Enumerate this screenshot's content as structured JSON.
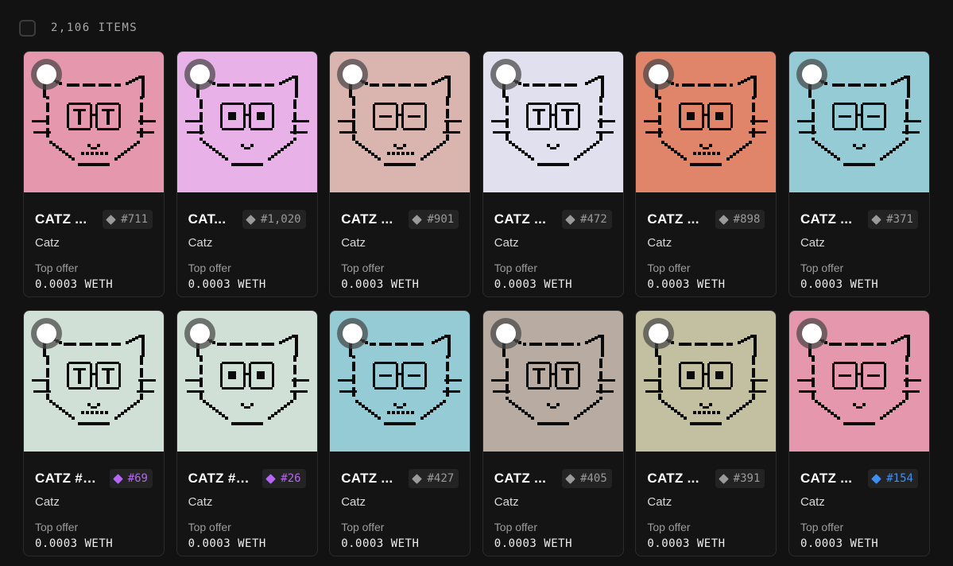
{
  "header": {
    "item_count": "2,106 ITEMS"
  },
  "colors": {
    "rank_grey": "#9a9a9a",
    "rank_purple": "#b566f2",
    "rank_blue": "#3f8ff2"
  },
  "cards": [
    {
      "title": "CATZ ...",
      "rank": "#711",
      "rank_color": "grey",
      "bg": "#e597ad",
      "collection": "Catz",
      "offer_label": "Top offer",
      "offer_value": "0.0003 WETH"
    },
    {
      "title": "CAT...",
      "rank": "#1,020",
      "rank_color": "grey",
      "bg": "#e8b1e8",
      "collection": "Catz",
      "offer_label": "Top offer",
      "offer_value": "0.0003 WETH"
    },
    {
      "title": "CATZ ...",
      "rank": "#901",
      "rank_color": "grey",
      "bg": "#dab4af",
      "collection": "Catz",
      "offer_label": "Top offer",
      "offer_value": "0.0003 WETH"
    },
    {
      "title": "CATZ ...",
      "rank": "#472",
      "rank_color": "grey",
      "bg": "#e0e0ef",
      "collection": "Catz",
      "offer_label": "Top offer",
      "offer_value": "0.0003 WETH"
    },
    {
      "title": "CATZ ...",
      "rank": "#898",
      "rank_color": "grey",
      "bg": "#e0846a",
      "collection": "Catz",
      "offer_label": "Top offer",
      "offer_value": "0.0003 WETH"
    },
    {
      "title": "CATZ ...",
      "rank": "#371",
      "rank_color": "grey",
      "bg": "#95cbd4",
      "collection": "Catz",
      "offer_label": "Top offer",
      "offer_value": "0.0003 WETH"
    },
    {
      "title": "CATZ #1...",
      "rank": "#69",
      "rank_color": "purple",
      "bg": "#d1e0d6",
      "collection": "Catz",
      "offer_label": "Top offer",
      "offer_value": "0.0003 WETH"
    },
    {
      "title": "CATZ #1...",
      "rank": "#26",
      "rank_color": "purple",
      "bg": "#d1e0d6",
      "collection": "Catz",
      "offer_label": "Top offer",
      "offer_value": "0.0003 WETH"
    },
    {
      "title": "CATZ ...",
      "rank": "#427",
      "rank_color": "grey",
      "bg": "#95cbd4",
      "collection": "Catz",
      "offer_label": "Top offer",
      "offer_value": "0.0003 WETH"
    },
    {
      "title": "CATZ ...",
      "rank": "#405",
      "rank_color": "grey",
      "bg": "#b8aba2",
      "collection": "Catz",
      "offer_label": "Top offer",
      "offer_value": "0.0003 WETH"
    },
    {
      "title": "CATZ ...",
      "rank": "#391",
      "rank_color": "grey",
      "bg": "#c2c0a1",
      "collection": "Catz",
      "offer_label": "Top offer",
      "offer_value": "0.0003 WETH"
    },
    {
      "title": "CATZ ...",
      "rank": "#154",
      "rank_color": "blue",
      "bg": "#e597ad",
      "collection": "Catz",
      "offer_label": "Top offer",
      "offer_value": "0.0003 WETH"
    }
  ]
}
